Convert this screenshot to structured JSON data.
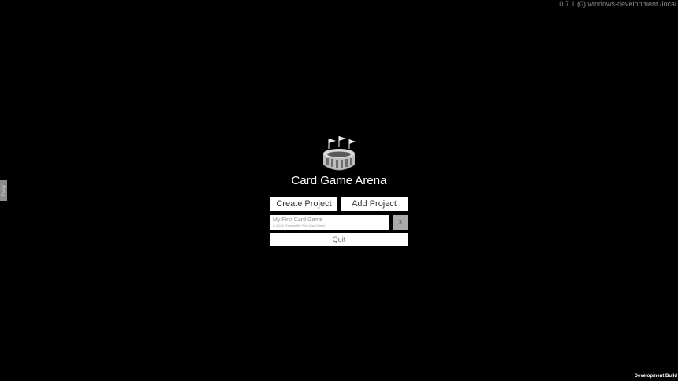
{
  "version_text": "0.7.1 (0) windows-development /local",
  "party_tab_label": "Party",
  "logo_icon": "stadium-with-flags-icon",
  "app_title": "Card Game Arena",
  "buttons": {
    "create_project": "Create Project",
    "add_project": "Add Project",
    "quit": "Quit"
  },
  "recent_projects": [
    {
      "name": "My First Card Game",
      "path": "C:/CGA Projects/My First Card Game",
      "remove_label": "X"
    }
  ],
  "footer": {
    "build_label": "Development Build"
  },
  "colors": {
    "background": "#000000",
    "button_bg": "#ffffff",
    "remove_button_bg": "#a9a9a9",
    "version_text": "#8a8a8a"
  }
}
